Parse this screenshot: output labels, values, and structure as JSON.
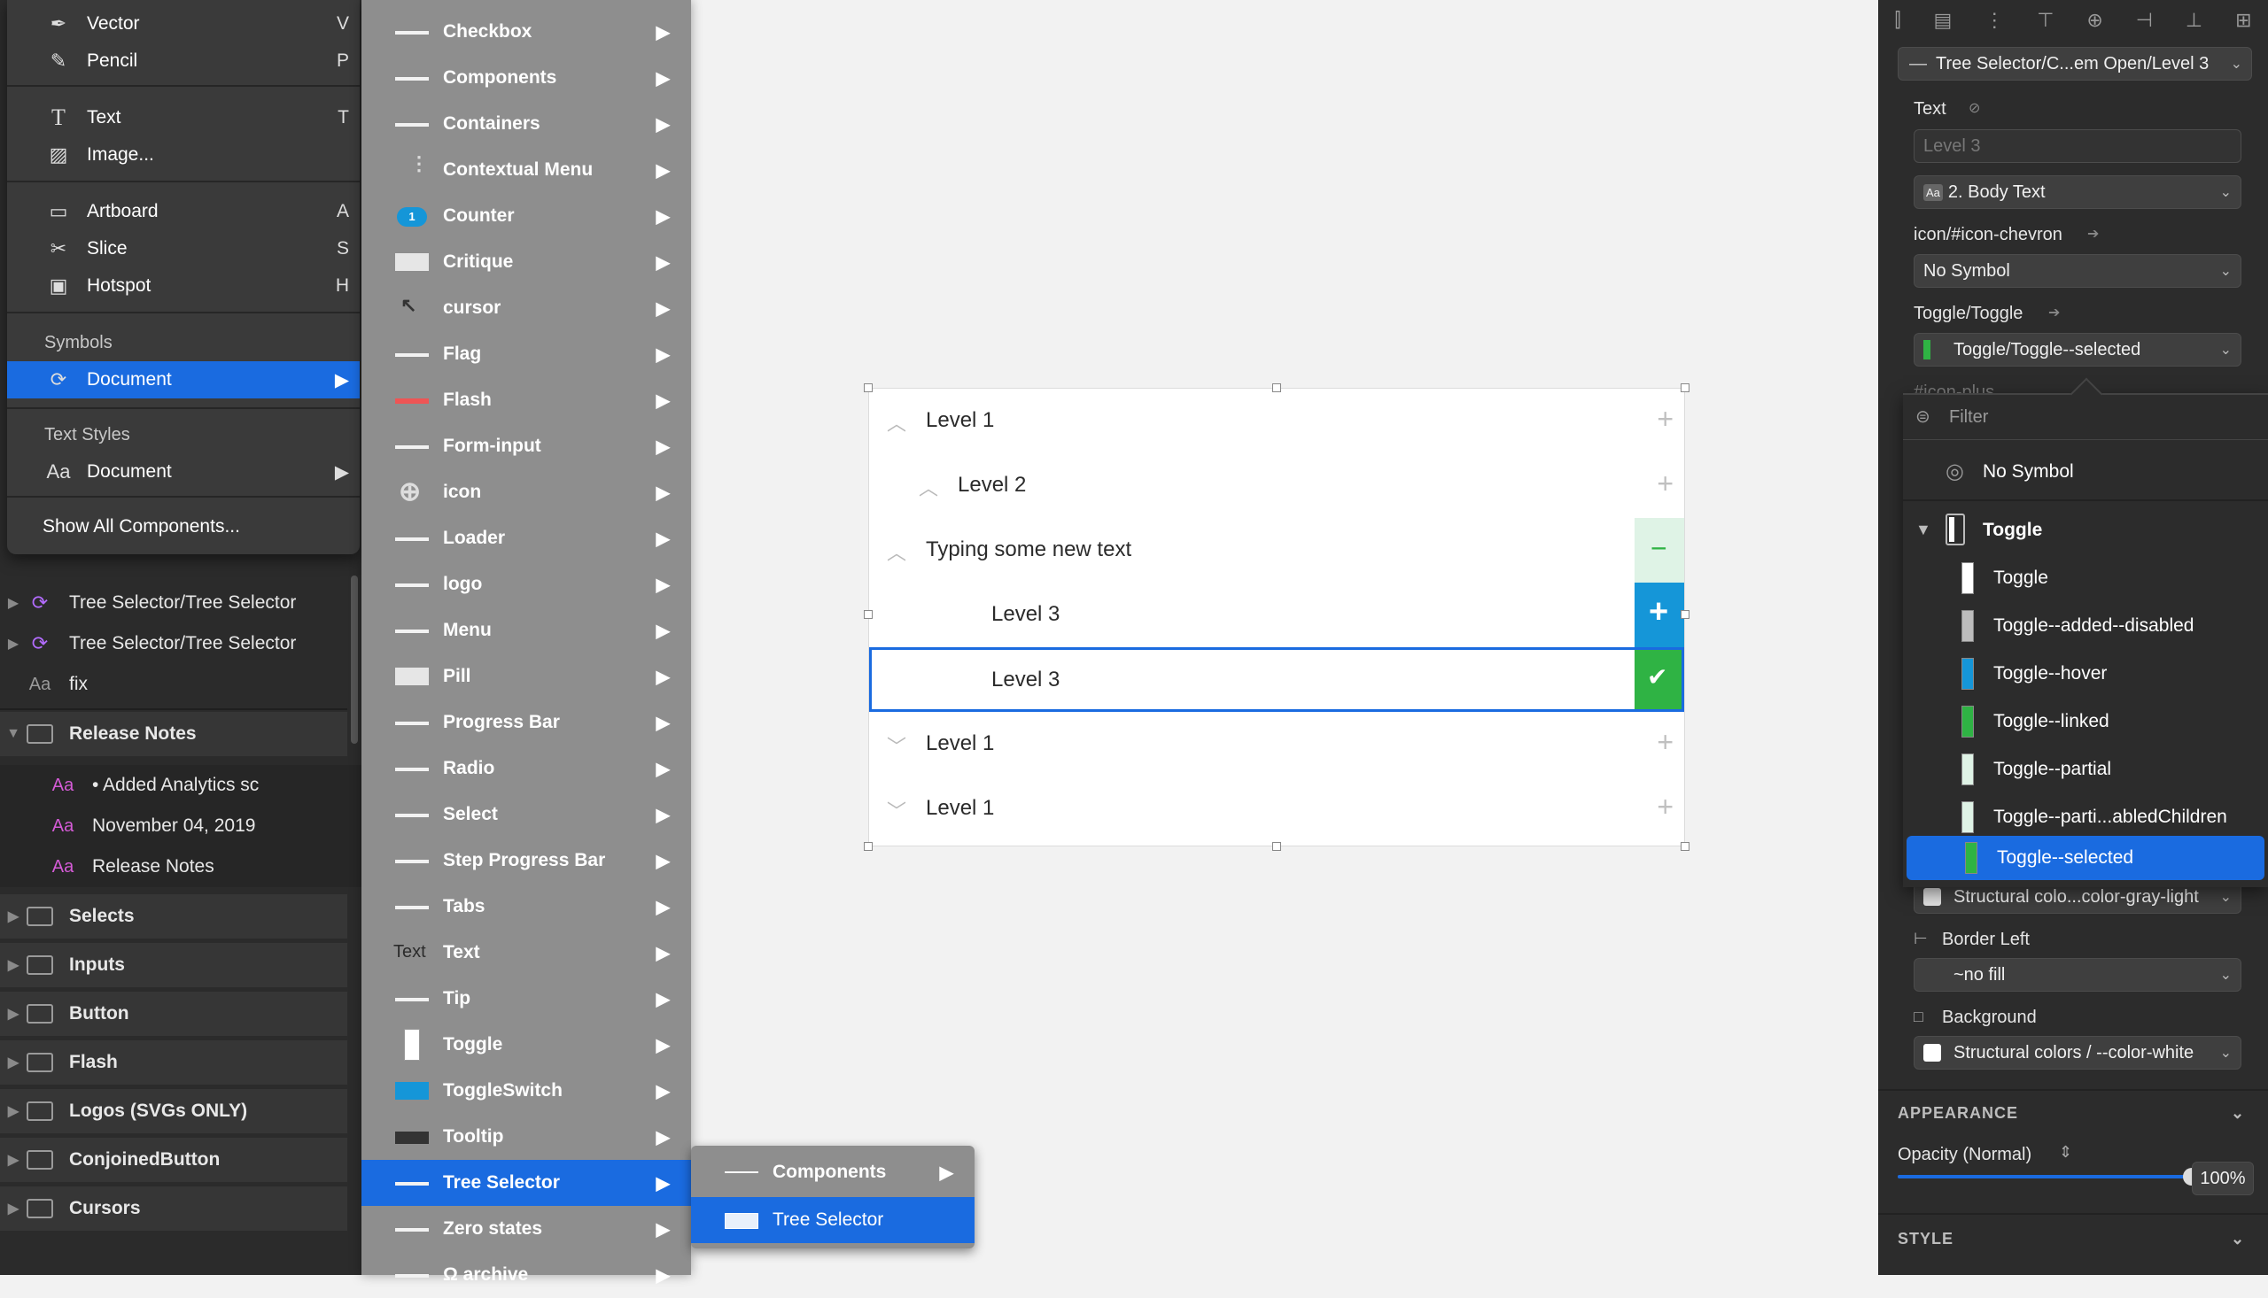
{
  "insert_menu": {
    "items": [
      {
        "label": "Vector",
        "shortcut": "V",
        "icon": "pen-icon"
      },
      {
        "label": "Pencil",
        "shortcut": "P",
        "icon": "pencil-icon"
      },
      {
        "label": "Text",
        "shortcut": "T",
        "icon": "text-icon"
      },
      {
        "label": "Image...",
        "shortcut": "",
        "icon": "image-icon"
      },
      {
        "label": "Artboard",
        "shortcut": "A",
        "icon": "artboard-icon"
      },
      {
        "label": "Slice",
        "shortcut": "S",
        "icon": "slice-icon"
      },
      {
        "label": "Hotspot",
        "shortcut": "H",
        "icon": "hotspot-icon"
      }
    ],
    "symbols_header": "Symbols",
    "symbols_document": "Document",
    "text_styles_header": "Text Styles",
    "text_styles_document": "Document",
    "text_styles_prefix": "Aa",
    "show_all": "Show All Components..."
  },
  "layers": {
    "rows": [
      {
        "label": "Tree Selector/Tree Selector",
        "kind": "symbol"
      },
      {
        "label": "Tree Selector/Tree Selector",
        "kind": "symbol"
      },
      {
        "label": "fix",
        "kind": "text"
      }
    ],
    "release_group": "Release Notes",
    "release_children": [
      "• Added Analytics sc",
      "November 04, 2019",
      "Release Notes"
    ],
    "groups": [
      "Selects",
      "Inputs",
      "Button",
      "Flash",
      "Logos (SVGs ONLY)",
      "ConjoinedButton",
      "Cursors"
    ]
  },
  "symbols_menu": {
    "items": [
      "Checkbox",
      "Components",
      "Containers",
      "Contextual Menu",
      "Counter",
      "Critique",
      "cursor",
      "Flag",
      "Flash",
      "Form-input",
      "icon",
      "Loader",
      "logo",
      "Menu",
      "Pill",
      "Progress Bar",
      "Radio",
      "Select",
      "Step Progress Bar",
      "Tabs",
      "Text",
      "Tip",
      "Toggle",
      "ToggleSwitch",
      "Tooltip",
      "Tree Selector",
      "Zero states",
      "Ω archive"
    ],
    "selected": "Tree Selector",
    "thumb_text_label": "Text",
    "counter_badge": "1"
  },
  "submenu": {
    "items": [
      "Components",
      "Tree Selector"
    ],
    "selected": "Tree Selector"
  },
  "tree_selector": {
    "rows": [
      {
        "label": "Level 1",
        "chevron": "up",
        "action": "plus"
      },
      {
        "label": "Level 2",
        "chevron": "up",
        "action": "plus"
      },
      {
        "label": "Typing some new text",
        "chevron": "up",
        "action": "minus"
      },
      {
        "label": "Level 3",
        "chevron": "",
        "action": "plus-blue"
      },
      {
        "label": "Level 3",
        "chevron": "",
        "action": "check-green"
      },
      {
        "label": "Level 1",
        "chevron": "down",
        "action": "plus"
      },
      {
        "label": "Level 1",
        "chevron": "down",
        "action": "plus"
      }
    ],
    "colors": {
      "blue": "#1596d8",
      "green": "#2fb344",
      "minus_bg": "#dff3e6",
      "focus": "#1a6be0"
    }
  },
  "inspector": {
    "symbol_name": "Tree Selector/C...em Open/Level 3",
    "text_label": "Text",
    "text_placeholder": "Level 3",
    "text_style": "2. Body Text",
    "text_style_prefix": "Aa",
    "icon_override_label": "icon/#icon-chevron",
    "icon_override_value": "No Symbol",
    "toggle_label": "Toggle/Toggle",
    "toggle_value": "Toggle/Toggle--selected",
    "partial_label": "#icon-plus",
    "filter_placeholder": "Filter",
    "no_symbol": "No Symbol",
    "toggle_group": "Toggle",
    "toggle_items": [
      "Toggle",
      "Toggle--added--disabled",
      "Toggle--hover",
      "Toggle--linked",
      "Toggle--partial",
      "Toggle--parti...abledChildren",
      "Toggle--selected"
    ],
    "toggle_item_colors": [
      "#ffffff",
      "#bdbdbd",
      "#1596d8",
      "#2fb344",
      "#dff3e6",
      "#dff3e6",
      "#2fb344"
    ],
    "structural_light": "Structural colo...color-gray-light",
    "border_left_label": "Border Left",
    "border_left_value": "~no fill",
    "background_label": "Background",
    "background_value": "Structural colors / --color-white",
    "appearance_section": "APPEARANCE",
    "opacity_label": "Opacity (Normal)",
    "opacity_value": "100%",
    "opacity_level": 1.0,
    "style_section": "STYLE"
  }
}
